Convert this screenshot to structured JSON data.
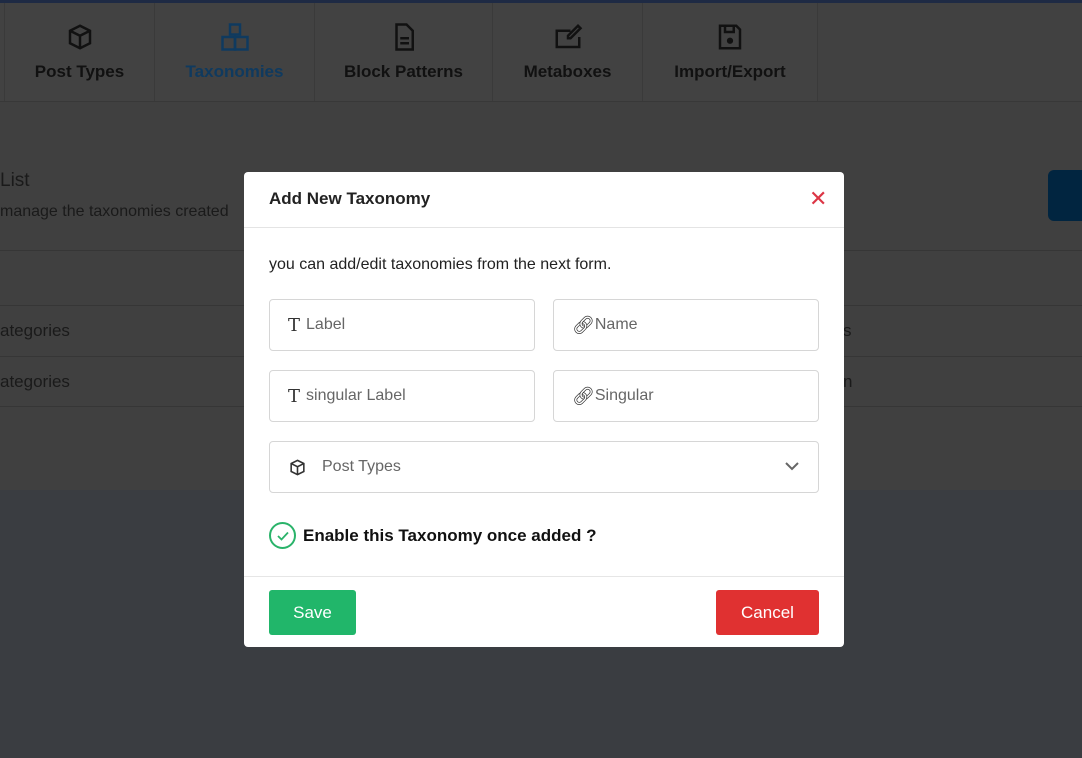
{
  "tabs": [
    {
      "label": "Post Types",
      "icon": "cube-icon"
    },
    {
      "label": "Taxonomies",
      "icon": "boxes-icon",
      "active": true
    },
    {
      "label": "Block Patterns",
      "icon": "file-icon"
    },
    {
      "label": "Metaboxes",
      "icon": "edit-box-icon"
    },
    {
      "label": "Import/Export",
      "icon": "floppy-icon"
    }
  ],
  "page": {
    "title": "List",
    "description": "manage the taxonomies created",
    "rows": [
      {
        "left": "ategories",
        "right": "s"
      },
      {
        "left": "ategories",
        "right": "n"
      }
    ]
  },
  "modal": {
    "title": "Add New Taxonomy",
    "intro": "you can add/edit taxonomies from the next form.",
    "label_placeholder": "Label",
    "name_placeholder": "Name",
    "singular_label_placeholder": "singular Label",
    "singular_placeholder": "Singular",
    "post_types_placeholder": "Post Types",
    "enable_label": "Enable this Taxonomy once added ?",
    "enable_checked": true,
    "save": "Save",
    "cancel": "Cancel"
  },
  "colors": {
    "accent": "#0f3a5f",
    "save": "#21b66a",
    "cancel": "#e03131",
    "close": "#dc3545"
  }
}
